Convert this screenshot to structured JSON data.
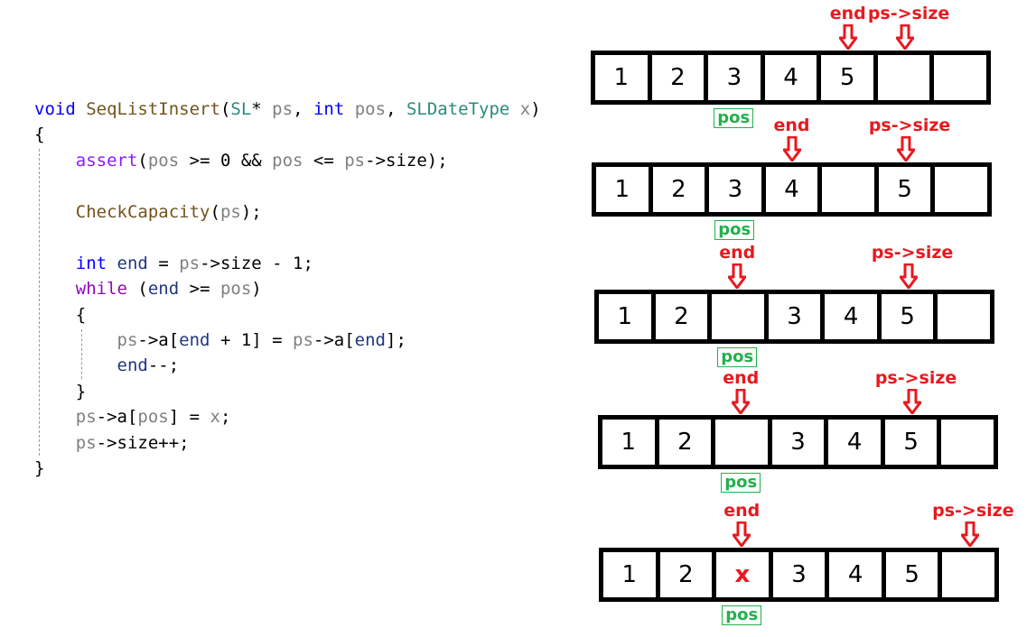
{
  "code": [
    [
      [
        "kw",
        "void"
      ],
      [
        "pl",
        " "
      ],
      [
        "fn",
        "SeqListInsert"
      ],
      [
        "pl",
        "("
      ],
      [
        "ty",
        "SL"
      ],
      [
        "pl",
        "* "
      ],
      [
        "pm",
        "ps"
      ],
      [
        "pl",
        ", "
      ],
      [
        "kw",
        "int"
      ],
      [
        "pl",
        " "
      ],
      [
        "pm",
        "pos"
      ],
      [
        "pl",
        ", "
      ],
      [
        "ty",
        "SLDateType"
      ],
      [
        "pl",
        " "
      ],
      [
        "pm",
        "x"
      ],
      [
        "pl",
        ")"
      ]
    ],
    [
      [
        "pl",
        "{"
      ]
    ],
    [
      [
        "pl",
        "    "
      ],
      [
        "mc",
        "assert"
      ],
      [
        "pl",
        "("
      ],
      [
        "pm",
        "pos"
      ],
      [
        "pl",
        " >= 0 && "
      ],
      [
        "pm",
        "pos"
      ],
      [
        "pl",
        " <= "
      ],
      [
        "pm",
        "ps"
      ],
      [
        "pl",
        "->size);"
      ]
    ],
    [],
    [
      [
        "pl",
        "    "
      ],
      [
        "fn",
        "CheckCapacity"
      ],
      [
        "pl",
        "("
      ],
      [
        "pm",
        "ps"
      ],
      [
        "pl",
        ");"
      ]
    ],
    [],
    [
      [
        "pl",
        "    "
      ],
      [
        "kw",
        "int"
      ],
      [
        "pl",
        " "
      ],
      [
        "lc",
        "end"
      ],
      [
        "pl",
        " = "
      ],
      [
        "pm",
        "ps"
      ],
      [
        "pl",
        "->size - 1;"
      ]
    ],
    [
      [
        "pl",
        "    "
      ],
      [
        "ct",
        "while"
      ],
      [
        "pl",
        " ("
      ],
      [
        "lc",
        "end"
      ],
      [
        "pl",
        " >= "
      ],
      [
        "pm",
        "pos"
      ],
      [
        "pl",
        ")"
      ]
    ],
    [
      [
        "pl",
        "    {"
      ]
    ],
    [
      [
        "pl",
        "        "
      ],
      [
        "pm",
        "ps"
      ],
      [
        "pl",
        "->a["
      ],
      [
        "lc",
        "end"
      ],
      [
        "pl",
        " + 1] = "
      ],
      [
        "pm",
        "ps"
      ],
      [
        "pl",
        "->a["
      ],
      [
        "lc",
        "end"
      ],
      [
        "pl",
        "];"
      ]
    ],
    [
      [
        "pl",
        "        "
      ],
      [
        "lc",
        "end"
      ],
      [
        "pl",
        "--;"
      ]
    ],
    [
      [
        "pl",
        "    }"
      ]
    ],
    [
      [
        "pl",
        "    "
      ],
      [
        "pm",
        "ps"
      ],
      [
        "pl",
        "->a["
      ],
      [
        "pm",
        "pos"
      ],
      [
        "pl",
        "] = "
      ],
      [
        "pm",
        "x"
      ],
      [
        "pl",
        ";"
      ]
    ],
    [
      [
        "pl",
        "    "
      ],
      [
        "pm",
        "ps"
      ],
      [
        "pl",
        "->size++;"
      ]
    ],
    [
      [
        "pl",
        "}"
      ]
    ]
  ],
  "labels": {
    "end": "end",
    "size": "ps->size",
    "pos": "pos"
  },
  "colors": {
    "pointer": "#e8191f",
    "pos": "#22b14c"
  },
  "arrays": [
    {
      "cells": [
        "1",
        "2",
        "3",
        "4",
        "5",
        "",
        ""
      ],
      "end_index": 4,
      "size_index": 5,
      "pos_index": 2
    },
    {
      "cells": [
        "1",
        "2",
        "3",
        "4",
        "",
        "5",
        ""
      ],
      "end_index": 3,
      "size_index": 5,
      "pos_index": 2
    },
    {
      "cells": [
        "1",
        "2",
        "",
        "3",
        "4",
        "5",
        ""
      ],
      "end_index": 2,
      "size_index": 5,
      "pos_index": 2
    },
    {
      "cells": [
        "1",
        "2",
        "",
        "3",
        "4",
        "5",
        ""
      ],
      "end_index": 2,
      "size_index": 5,
      "pos_index": 2
    },
    {
      "cells": [
        "1",
        "2",
        "x",
        "3",
        "4",
        "5",
        ""
      ],
      "end_index": 2,
      "size_index": 6,
      "pos_index": 2,
      "highlight_index": 2
    }
  ]
}
